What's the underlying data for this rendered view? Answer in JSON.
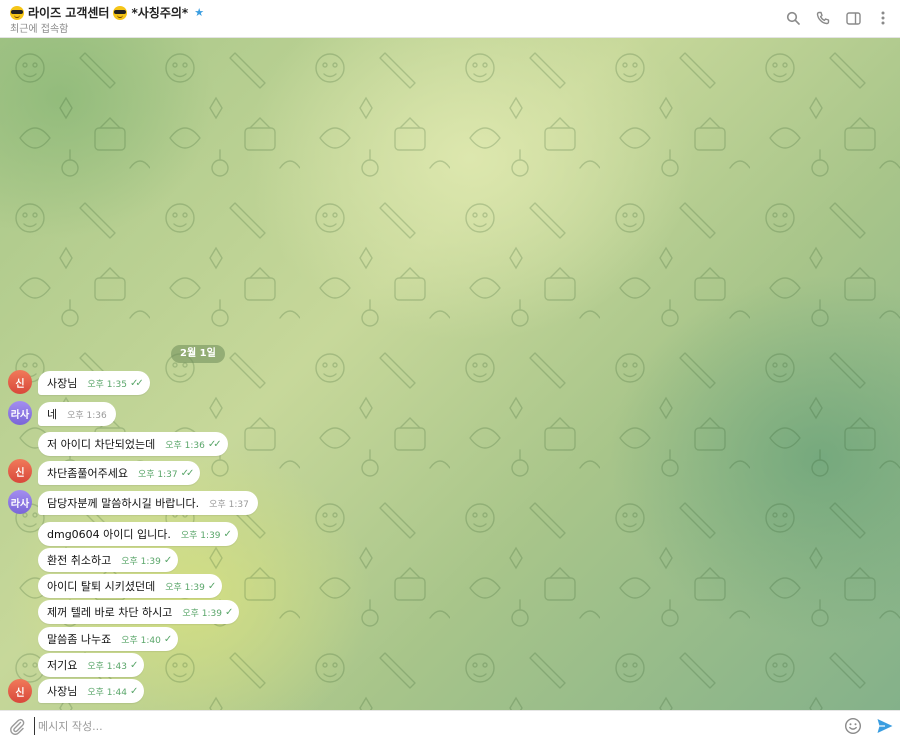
{
  "header": {
    "title": "라이즈 고객센터",
    "title_suffix": "*사칭주의*",
    "verified_glyph": "★",
    "status": "최근에 접속함",
    "icons": [
      "search-icon",
      "phone-icon",
      "sidebar-icon",
      "more-icon"
    ]
  },
  "chat": {
    "date_label": "2월 1일",
    "messages": [
      {
        "avatar": "신",
        "text": "사장님",
        "time": "오후 1:35",
        "read": true
      },
      {
        "avatar": "라사",
        "text": "네",
        "time": "오후 1:36",
        "read": false
      },
      {
        "avatar": "",
        "text": "저 아이디 차단되었는데",
        "time": "오후 1:36",
        "read": true
      },
      {
        "avatar": "신",
        "text": "차단좀풀어주세요",
        "time": "오후 1:37",
        "read": true
      },
      {
        "avatar": "라사",
        "text": "담당자분께 말씀하시길 바랍니다.",
        "time": "오후 1:37",
        "read": false
      },
      {
        "avatar": "",
        "text": "dmg0604 아이디 입니다.",
        "time": "오후 1:39",
        "read": true
      },
      {
        "avatar": "",
        "text": "환전 취소하고",
        "time": "오후 1:39",
        "read": true
      },
      {
        "avatar": "",
        "text": "아이디 탈퇴 시키셨던데",
        "time": "오후 1:39",
        "read": true
      },
      {
        "avatar": "",
        "text": "제꺼 텔레 바로 차단 하시고",
        "time": "오후 1:39",
        "read": true
      },
      {
        "avatar": "",
        "text": "말씀좀 나누죠",
        "time": "오후 1:40",
        "read": true
      },
      {
        "avatar": "",
        "text": "저기요",
        "time": "오후 1:43",
        "read": true
      },
      {
        "avatar": "신",
        "text": "사장님",
        "time": "오후 1:44",
        "read": true
      }
    ]
  },
  "composer": {
    "placeholder": "메시지 작성...",
    "value": ""
  },
  "colors": {
    "accent": "#3a9de0",
    "time_green": "#5aa66a",
    "avatar_red": "#e0573f",
    "avatar_purple": "#8a76e0"
  }
}
